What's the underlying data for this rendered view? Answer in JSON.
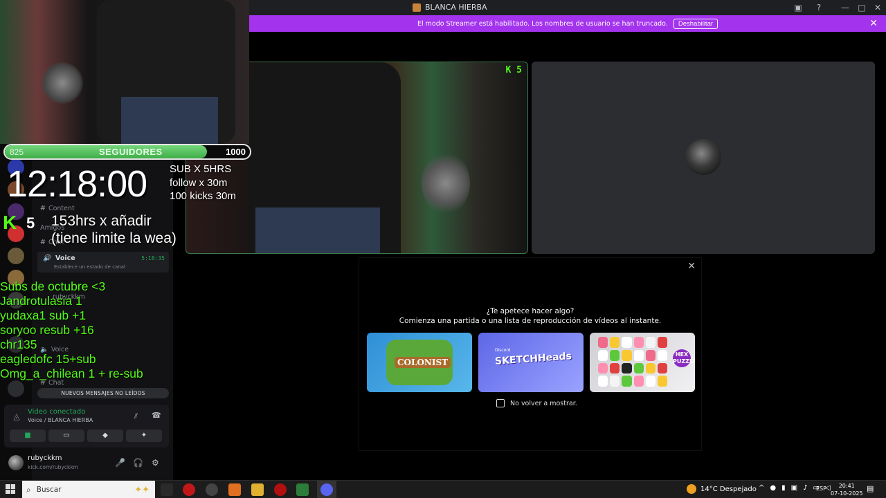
{
  "window": {
    "title": "BLANCA HIERBA"
  },
  "banner": {
    "text": "El modo Streamer está habilitado. Los nombres de usuario se han truncado.",
    "button": "Deshabilitar"
  },
  "overlay": {
    "followers": {
      "current": "825",
      "label": "SEGUIDORES",
      "goal": "1000",
      "progress": 0.825
    },
    "timer": "12:18:00",
    "rules": [
      "SUB X 5HRS",
      "follow x 30m",
      "100 kicks 30m"
    ],
    "add_hours": [
      "153hrs  x añadir",
      "(tiene limite la wea)"
    ],
    "kick_count": "5",
    "kick_badge": "K 5",
    "subs_list": [
      "Subs de octubre <3",
      "Jandrotulasia 1",
      "yudaxa1 sub +1",
      "soryoo resub +16",
      "chr135",
      "eagledofc 15+sub",
      "Omg_a_chilean 1 + re-sub"
    ]
  },
  "sidebar": {
    "channels": [
      {
        "name": "Content",
        "type": "text"
      },
      {
        "name": "Amigos",
        "type": "category"
      },
      {
        "name": "Chat",
        "type": "text"
      },
      {
        "name": "Chat",
        "type": "text"
      }
    ],
    "active_voice": {
      "name": "Voice",
      "time": "5:18:35",
      "status": "Establece un estado de canal"
    },
    "voice_user": "rubyckkm",
    "categories": [
      "Voice",
      "Voice"
    ],
    "unread_banner": "NUEVOS MENSAJES NO LEÍDOS"
  },
  "voice_panel": {
    "status": "Video conectado",
    "channel": "Voice / BLANCA HIERBA"
  },
  "user_panel": {
    "username": "rubyckkm",
    "subtitle": "kick.com/rubyckkm"
  },
  "activity": {
    "heading": "¿Te apetece hacer algo?",
    "subheading": "Comienza una partida o una lista de reproducción de vídeos al instante.",
    "games": [
      {
        "name": "COLONIST"
      },
      {
        "name": "SKETCHHeads",
        "small": "Discord"
      },
      {
        "name": "HEX PUZZLE"
      }
    ],
    "checkbox_label": "No volver a mostrar."
  },
  "taskbar": {
    "search_placeholder": "Buscar",
    "weather": "14°C  Despejado",
    "lang": "ESP",
    "time": "20:41",
    "date": "07-10-2025"
  },
  "colors": {
    "banner": "#a333ec",
    "kick_green": "#53fc18",
    "voice_green": "#23a55a"
  }
}
